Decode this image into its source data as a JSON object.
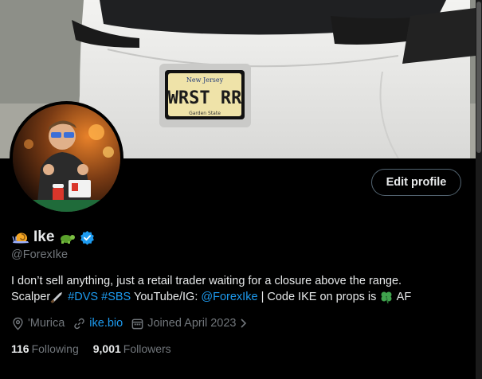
{
  "banner": {
    "plate_state": "New Jersey",
    "plate_text": "WRST RR",
    "plate_slogan": "Garden State"
  },
  "profile": {
    "name": "Ike",
    "handle": "@ForexIke",
    "edit_button": "Edit profile",
    "verified_color": "#1d9bf0"
  },
  "bio": {
    "line1": "I don’t sell anything, just a retail trader waiting for a closure above the range.",
    "scalper": "Scalper",
    "tag1": "#DVS",
    "tag2": "#SBS",
    "youtube": "YouTube/IG:",
    "mention": "@ForexIke",
    "code_text": "| Code IKE on props is",
    "af": "AF"
  },
  "meta": {
    "location": "'Murica",
    "website": "ike.bio",
    "joined": "Joined April 2023"
  },
  "stats": {
    "following_count": "116",
    "following_label": "Following",
    "followers_count": "9,001",
    "followers_label": "Followers"
  }
}
